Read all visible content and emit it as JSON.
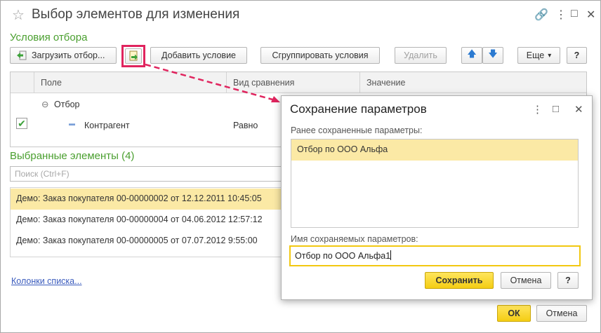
{
  "window": {
    "title": "Выбор элементов для изменения",
    "controls": {
      "link": "🔗",
      "menu": "⋮",
      "maximize": "□",
      "close": "✕"
    }
  },
  "conditions": {
    "title": "Условия отбора",
    "toolbar": {
      "load_label": "Загрузить отбор...",
      "add_label": "Добавить условие",
      "group_label": "Сгруппировать условия",
      "delete_label": "Удалить",
      "up": "🡅",
      "down": "🡇",
      "more_label": "Еще",
      "more_arrow": "▾",
      "help_label": "?"
    },
    "columns": [
      "Поле",
      "Вид сравнения",
      "Значение"
    ],
    "rows": [
      {
        "expander": "⊖",
        "field": "Отбор"
      },
      {
        "checked": "✔",
        "dash": "▬",
        "field": "Контрагент",
        "comparison": "Равно"
      }
    ]
  },
  "selected": {
    "title": "Выбранные элементы (4)",
    "search_placeholder": "Поиск (Ctrl+F)",
    "items": [
      "Демо: Заказ покупателя 00-00000002 от 12.12.2011 10:45:05",
      "Демо: Заказ покупателя 00-00000004 от 04.06.2012 12:57:12",
      "Демо: Заказ покупателя 00-00000005 от 07.07.2012 9:55:00"
    ]
  },
  "columns_link": "Колонки списка...",
  "footer": {
    "ok_label": "ОК",
    "cancel_label": "Отмена"
  },
  "dialog": {
    "title": "Сохранение параметров",
    "controls": {
      "menu": "⋮",
      "maximize": "□",
      "close": "✕"
    },
    "saved_label": "Ранее сохраненные параметры:",
    "saved_items": [
      "Отбор по ООО Альфа"
    ],
    "name_label": "Имя сохраняемых параметров:",
    "name_value": "Отбор по ООО Альфа1",
    "save_label": "Сохранить",
    "cancel_label": "Отмена",
    "help_label": "?"
  },
  "colors": {
    "accent_green": "#4a9f2f",
    "highlight_pink": "#e0245e",
    "selection_yellow": "#fbe9a5",
    "button_yellow": "#f4cd13"
  }
}
